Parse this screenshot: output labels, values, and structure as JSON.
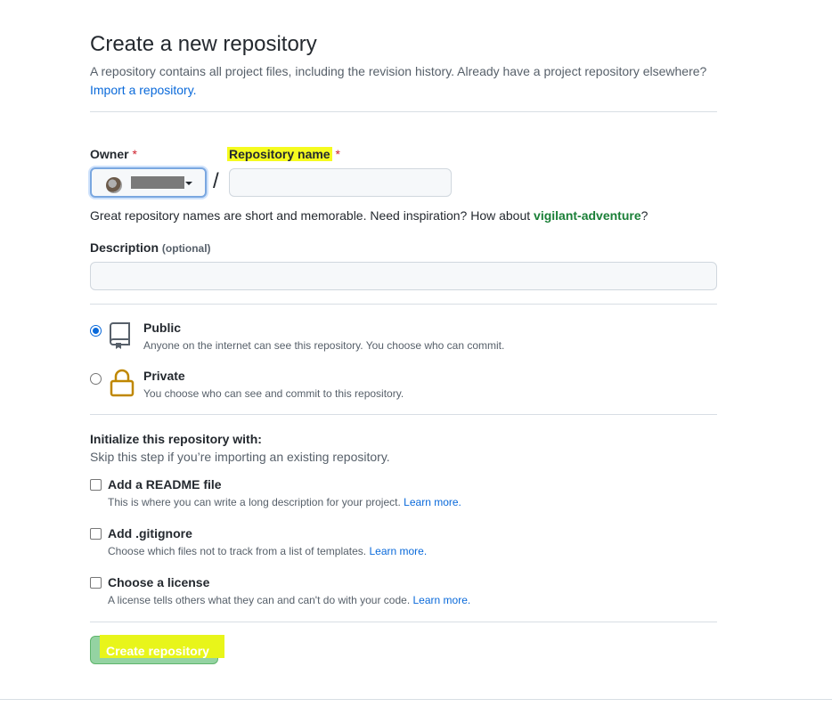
{
  "page": {
    "title": "Create a new repository",
    "subtitle": "A repository contains all project files, including the revision history. Already have a project repository elsewhere?",
    "import_link": "Import a repository."
  },
  "owner": {
    "label": "Owner",
    "required_mark": "*"
  },
  "repo": {
    "label": "Repository name",
    "required_mark": "*",
    "value": "",
    "slash": "/"
  },
  "hint": {
    "text": "Great repository names are short and memorable. Need inspiration? How about ",
    "suggestion": "vigilant-adventure",
    "end": "?"
  },
  "description": {
    "label": "Description",
    "optional": "(optional)",
    "value": ""
  },
  "visibility": [
    {
      "title": "Public",
      "desc": "Anyone on the internet can see this repository. You choose who can commit.",
      "checked": true,
      "icon": "repo-icon"
    },
    {
      "title": "Private",
      "desc": "You choose who can see and commit to this repository.",
      "checked": false,
      "icon": "lock-icon"
    }
  ],
  "init": {
    "title": "Initialize this repository with:",
    "subtitle": "Skip this step if you’re importing an existing repository.",
    "options": [
      {
        "title": "Add a README file",
        "desc": "This is where you can write a long description for your project.",
        "link": "Learn more."
      },
      {
        "title": "Add .gitignore",
        "desc": "Choose which files not to track from a list of templates.",
        "link": "Learn more."
      },
      {
        "title": "Choose a license",
        "desc": "A license tells others what they can and can't do with your code.",
        "link": "Learn more."
      }
    ]
  },
  "create_button": "Create repository",
  "colors": {
    "link": "#0969da",
    "suggestion": "#1a7f37",
    "required": "#cf222e",
    "highlight": "#f5fb1f",
    "create_bg": "#94d3a2"
  }
}
